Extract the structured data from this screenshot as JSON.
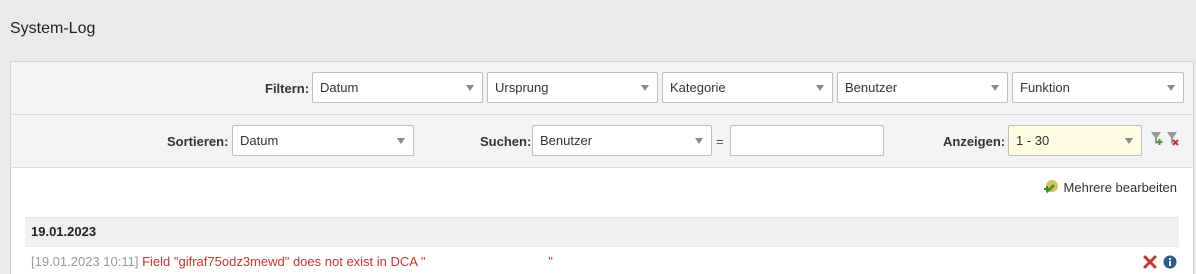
{
  "page": {
    "title": "System-Log"
  },
  "filter": {
    "label": "Filtern:",
    "selects": [
      {
        "name": "datum",
        "value": "Datum"
      },
      {
        "name": "ursprung",
        "value": "Ursprung"
      },
      {
        "name": "kategorie",
        "value": "Kategorie"
      },
      {
        "name": "benutzer",
        "value": "Benutzer"
      },
      {
        "name": "funktion",
        "value": "Funktion"
      }
    ]
  },
  "sort": {
    "label": "Sortieren:",
    "value": "Datum"
  },
  "search": {
    "label": "Suchen:",
    "field": "Benutzer",
    "equals": "=",
    "value": ""
  },
  "show": {
    "label": "Anzeigen:",
    "value": "1 - 30"
  },
  "actions": {
    "edit_multiple": "Mehrere bearbeiten"
  },
  "log": {
    "date": "19.01.2023",
    "entries": [
      {
        "time": "[19.01.2023 10:11]",
        "message": "Field \"gifraf75odz3mewd\" does not exist in DCA \"                                  \""
      }
    ]
  },
  "colors": {
    "error_text": "#cc3333",
    "highlight_select": "#fffce1",
    "delete_icon": "#c0392b",
    "info_icon": "#2c5d8f"
  }
}
